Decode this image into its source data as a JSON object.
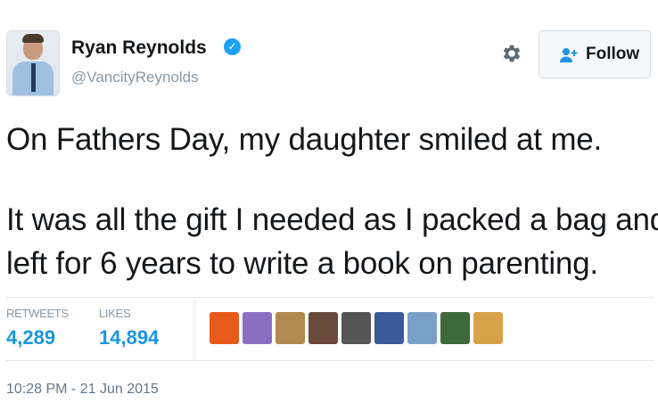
{
  "header": {
    "name": "Ryan Reynolds",
    "handle": "@VancityReynolds",
    "verified": "✓",
    "follow_label": "Follow"
  },
  "tweet": {
    "lines": [
      "On Fathers Day, my daughter smiled at me.",
      "It was all the gift I needed as I packed a bag and",
      "left for 6 years to write a book on parenting."
    ]
  },
  "stats": {
    "retweets_label": "RETWEETS",
    "retweets_value": "4,289",
    "likes_label": "LIKES",
    "likes_value": "14,894"
  },
  "likers": [
    {
      "icon": "liker-avatar-1",
      "color": "#e85a1c"
    },
    {
      "icon": "liker-avatar-2",
      "color": "#8a6fc0"
    },
    {
      "icon": "liker-avatar-3",
      "color": "#b08a50"
    },
    {
      "icon": "liker-avatar-4",
      "color": "#6a4a3a"
    },
    {
      "icon": "liker-avatar-5",
      "color": "#555555"
    },
    {
      "icon": "liker-avatar-6",
      "color": "#3b5a9a"
    },
    {
      "icon": "liker-avatar-7",
      "color": "#7aa0c8"
    },
    {
      "icon": "liker-avatar-8",
      "color": "#3e6a3a"
    },
    {
      "icon": "liker-avatar-9",
      "color": "#d7a24a"
    }
  ],
  "timestamp": "10:28 PM - 21 Jun 2015",
  "colors": {
    "accent": "#1b95e0",
    "verified": "#1da1f2",
    "muted": "#8899a6"
  }
}
